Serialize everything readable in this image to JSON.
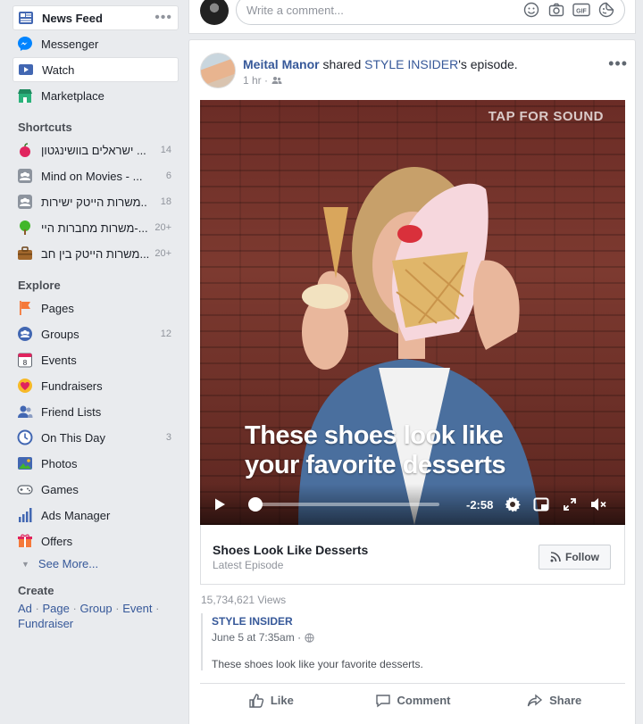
{
  "sidebar": {
    "main": [
      {
        "label": "News Feed",
        "icon": "news-feed-icon"
      },
      {
        "label": "Messenger",
        "icon": "messenger-icon"
      },
      {
        "label": "Watch",
        "icon": "watch-icon"
      },
      {
        "label": "Marketplace",
        "icon": "marketplace-icon"
      }
    ],
    "more_dots": "•••",
    "shortcuts_title": "Shortcuts",
    "shortcuts": [
      {
        "label": "ישראלים בוושינגטון ...",
        "count": "14",
        "icon": "apple-icon"
      },
      {
        "label": "Mind on Movies - ...",
        "count": "6",
        "icon": "group-icon"
      },
      {
        "label": "משרות הייטק ישירות..",
        "count": "18",
        "icon": "group-icon"
      },
      {
        "label": "משרות מחברות היי-...",
        "count": "20+",
        "icon": "tree-icon"
      },
      {
        "label": "משרות הייטק בין חב...",
        "count": "20+",
        "icon": "briefcase-icon"
      }
    ],
    "explore_title": "Explore",
    "explore": [
      {
        "label": "Pages",
        "count": "",
        "icon": "flag-icon"
      },
      {
        "label": "Groups",
        "count": "12",
        "icon": "groups-icon"
      },
      {
        "label": "Events",
        "count": "",
        "icon": "calendar-icon"
      },
      {
        "label": "Fundraisers",
        "count": "",
        "icon": "heart-icon"
      },
      {
        "label": "Friend Lists",
        "count": "",
        "icon": "friends-icon"
      },
      {
        "label": "On This Day",
        "count": "3",
        "icon": "clock-icon"
      },
      {
        "label": "Photos",
        "count": "",
        "icon": "photos-icon"
      },
      {
        "label": "Games",
        "count": "",
        "icon": "gamepad-icon"
      },
      {
        "label": "Ads Manager",
        "count": "",
        "icon": "bar-chart-icon"
      },
      {
        "label": "Offers",
        "count": "",
        "icon": "offers-icon"
      }
    ],
    "calendar_day": "8",
    "see_more": "See More...",
    "create_title": "Create",
    "create_links": [
      "Ad",
      "Page",
      "Group",
      "Event",
      "Fundraiser"
    ],
    "create_sep": "·"
  },
  "comment_bar": {
    "placeholder": "Write a comment...",
    "gif_label": "GIF"
  },
  "post": {
    "author": "Meital Manor",
    "shared_text": "shared",
    "page": "STYLE INSIDER",
    "suffix": "'s episode.",
    "time": "1 hr ·",
    "more": "•••",
    "video": {
      "tap_for_sound": "TAP FOR SOUND",
      "caption_line1": "These shoes look like",
      "caption_line2": "your favorite desserts",
      "time_remaining": "-2:58",
      "progress_fraction": 0.03
    },
    "episode": {
      "title": "Shoes Look Like Desserts",
      "subtitle": "Latest Episode",
      "follow_label": "Follow"
    },
    "views": "15,734,621 Views",
    "quote": {
      "author": "STYLE INSIDER",
      "time": "June 5 at 7:35am ·",
      "text": "These shoes look like your favorite desserts."
    },
    "actions": {
      "like": "Like",
      "comment": "Comment",
      "share": "Share"
    }
  },
  "colors": {
    "link": "#365899",
    "background": "#e9ebee",
    "muted": "#90949c"
  }
}
